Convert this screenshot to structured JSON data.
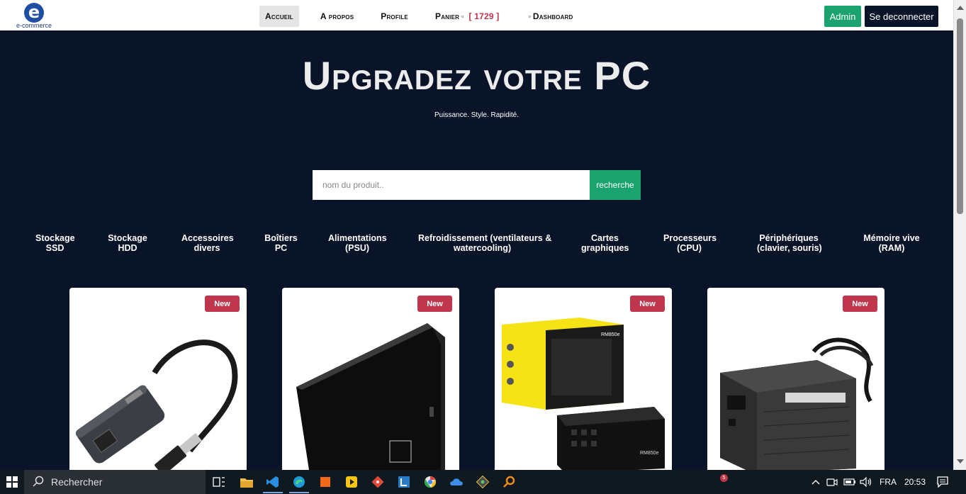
{
  "navbar": {
    "logo_text": "e-commerce",
    "logo_letter": "e",
    "links": [
      "Accueil",
      "A propos",
      "Profile",
      "Panier",
      "Dashboard"
    ],
    "cart_count": "[ 1729 ]",
    "admin_label": "Admin",
    "logout_label": "Se deconnecter"
  },
  "hero": {
    "title": "Upgradez votre PC",
    "subtitle": "Puissance. Style. Rapidité."
  },
  "search": {
    "placeholder": "nom du produit..",
    "button_label": "recherche"
  },
  "categories": [
    [
      "Stockage",
      "SSD"
    ],
    [
      "Stockage",
      "HDD"
    ],
    [
      "Accessoires",
      "divers"
    ],
    [
      "Boîtiers",
      "PC"
    ],
    [
      "Alimentations",
      "(PSU)"
    ],
    [
      "Refroidissement (ventilateurs &",
      "watercooling)"
    ],
    [
      "Cartes",
      "graphiques"
    ],
    [
      "Processeurs",
      "(CPU)"
    ],
    [
      "Périphériques",
      "(clavier, souris)"
    ],
    [
      "Mémoire vive",
      "(RAM)"
    ]
  ],
  "products": [
    {
      "badge": "New",
      "icon": "usb-ethernet-adapter-image"
    },
    {
      "badge": "New",
      "icon": "external-dvd-drive-image"
    },
    {
      "badge": "New",
      "icon": "corsair-psu-image"
    },
    {
      "badge": "New",
      "icon": "atx-psu-image"
    }
  ],
  "product_image_text": {
    "corsair_box": "RM850e",
    "corsair_unit": "RM850e"
  },
  "taskbar": {
    "search_placeholder": "Rechercher",
    "notification_count": "5",
    "language": "FRA",
    "time": "20:53"
  },
  "colors": {
    "background": "#0a1428",
    "accent_green": "#1aa36f",
    "badge_red": "#c0364c"
  }
}
